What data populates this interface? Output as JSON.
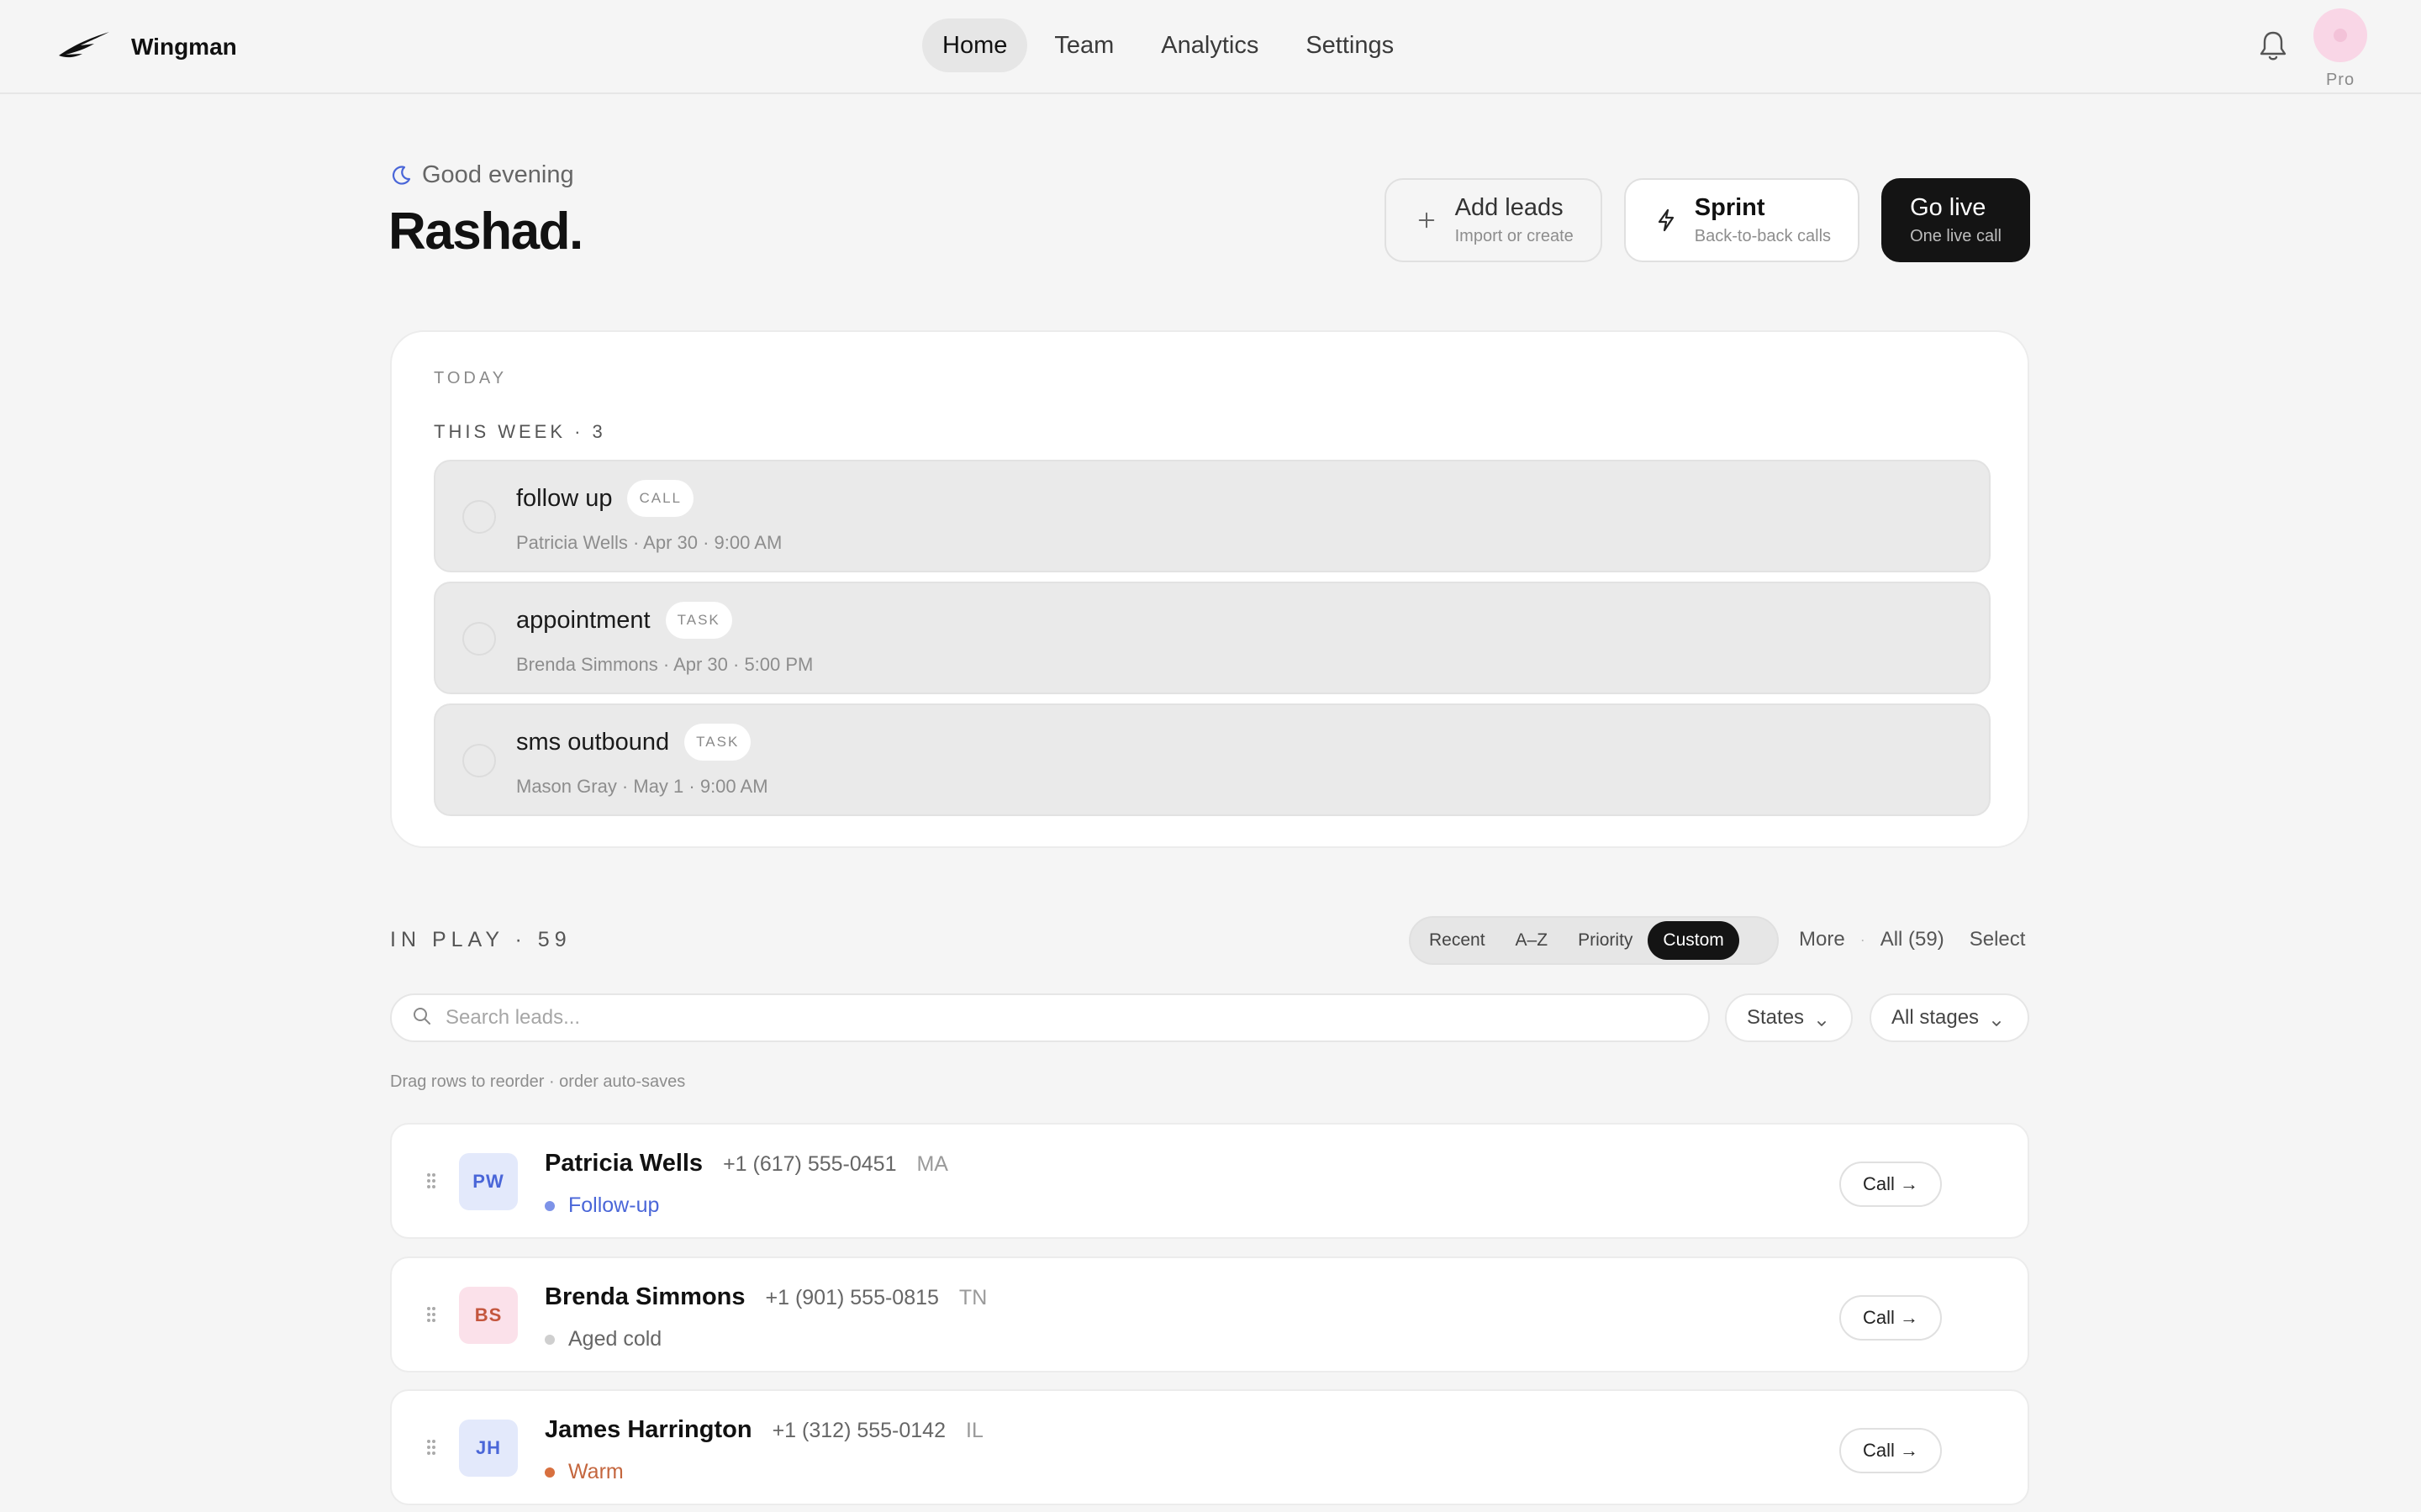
{
  "app": {
    "name": "Wingman"
  },
  "nav": {
    "items": [
      "Home",
      "Team",
      "Analytics",
      "Settings"
    ],
    "active": "Home"
  },
  "user": {
    "plan": "Pro"
  },
  "greeting": {
    "salutation": "Good evening",
    "name": "Rashad."
  },
  "actions": {
    "add_leads": {
      "title": "Add leads",
      "subtitle": "Import or create"
    },
    "sprint": {
      "title": "Sprint",
      "subtitle": "Back-to-back calls"
    },
    "go_live": {
      "title": "Go live",
      "subtitle": "One live call"
    }
  },
  "today": {
    "label": "TODAY",
    "week_label": "THIS WEEK · 3",
    "tasks": [
      {
        "title": "follow up",
        "type": "CALL",
        "meta": "Patricia Wells · Apr 30 · 9:00 AM"
      },
      {
        "title": "appointment",
        "type": "TASK",
        "meta": "Brenda Simmons · Apr 30 · 5:00 PM"
      },
      {
        "title": "sms outbound",
        "type": "TASK",
        "meta": "Mason Gray · May 1 · 9:00 AM"
      }
    ]
  },
  "in_play": {
    "label": "IN PLAY · 59",
    "sort_options": [
      "Recent",
      "A–Z",
      "Priority",
      "Custom"
    ],
    "active_sort": "Custom",
    "more": "More",
    "all": "All (59)",
    "select": "Select",
    "search_placeholder": "Search leads...",
    "filters": {
      "states": "States",
      "stages": "All stages"
    },
    "hint": "Drag rows to reorder · order auto-saves",
    "call_label": "Call →",
    "leads": [
      {
        "initials": "PW",
        "name": "Patricia Wells",
        "phone": "+1 (617) 555-0451",
        "state": "MA",
        "stage": "Follow-up",
        "stage_color": "#4a66d8",
        "dot_color": "#7d93e8",
        "avatar_bg": "#e3e9fb",
        "avatar_fg": "#4a66d8"
      },
      {
        "initials": "BS",
        "name": "Brenda Simmons",
        "phone": "+1 (901) 555-0815",
        "state": "TN",
        "stage": "Aged cold",
        "stage_color": "#666666",
        "dot_color": "#cfcfcf",
        "avatar_bg": "#fbe1ea",
        "avatar_fg": "#c4563e"
      },
      {
        "initials": "JH",
        "name": "James Harrington",
        "phone": "+1 (312) 555-0142",
        "state": "IL",
        "stage": "Warm",
        "stage_color": "#c4663e",
        "dot_color": "#d8703f",
        "avatar_bg": "#e3e9fb",
        "avatar_fg": "#4a66d8"
      }
    ]
  },
  "colors": {
    "accent_dark": "#141414",
    "background": "#f5f5f5"
  }
}
